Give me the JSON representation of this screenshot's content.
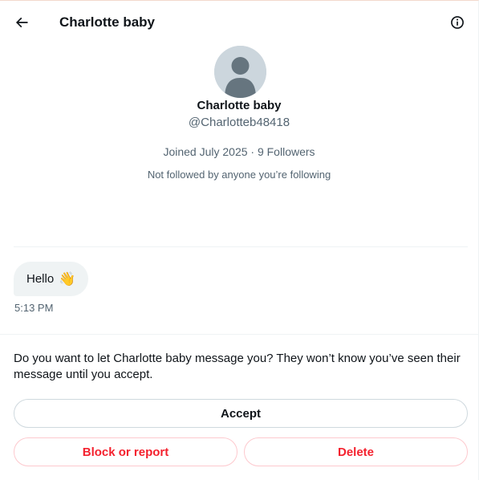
{
  "header": {
    "title": "Charlotte baby",
    "back_icon": "arrow-left-icon",
    "info_icon": "info-circle-icon"
  },
  "profile": {
    "name": "Charlotte baby",
    "handle": "@Charlotteb48418",
    "meta": "Joined July 2025 · 9 Followers",
    "note": "Not followed by anyone you’re following",
    "avatar_icon": "default-avatar-icon"
  },
  "messages": [
    {
      "text": "Hello",
      "emoji": "👋",
      "time": "5:13 PM"
    }
  ],
  "request": {
    "prompt": "Do you want to let Charlotte baby message you? They won’t know you’ve seen their message until you accept.",
    "accept_label": "Accept",
    "block_label": "Block or report",
    "delete_label": "Delete"
  },
  "colors": {
    "text_primary": "#0f1419",
    "text_secondary": "#536471",
    "danger": "#f4212e",
    "bubble_bg": "#eff3f4"
  }
}
